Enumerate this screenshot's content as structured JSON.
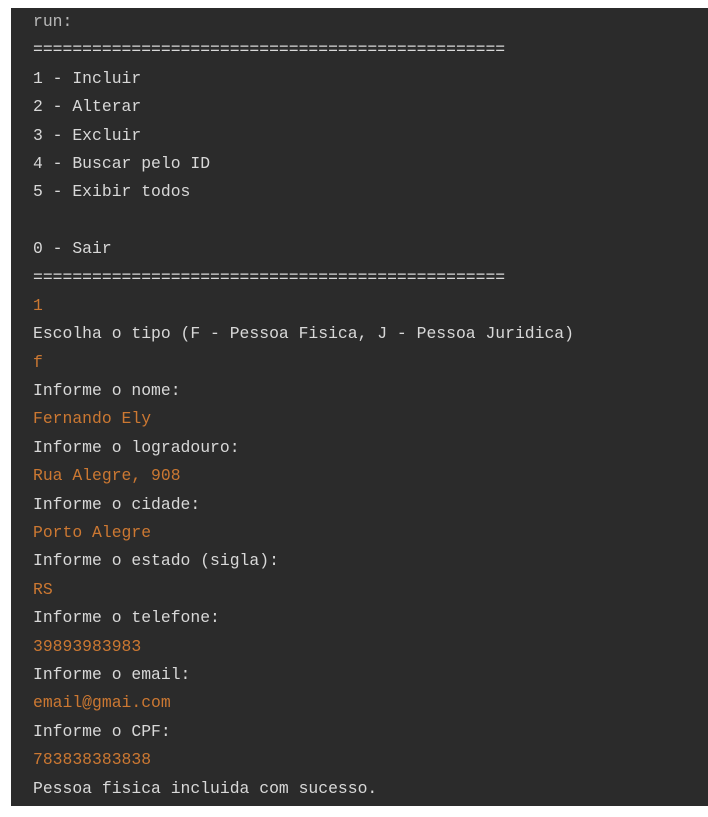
{
  "console": {
    "lines": [
      {
        "text": "run:",
        "kind": "header"
      },
      {
        "text": "================================================",
        "kind": "output"
      },
      {
        "text": "1 - Incluir",
        "kind": "output"
      },
      {
        "text": "2 - Alterar",
        "kind": "output"
      },
      {
        "text": "3 - Excluir",
        "kind": "output"
      },
      {
        "text": "4 - Buscar pelo ID",
        "kind": "output"
      },
      {
        "text": "5 - Exibir todos",
        "kind": "output"
      },
      {
        "text": "",
        "kind": "output"
      },
      {
        "text": "0 - Sair",
        "kind": "output"
      },
      {
        "text": "================================================",
        "kind": "output"
      },
      {
        "text": "1",
        "kind": "input"
      },
      {
        "text": "Escolha o tipo (F - Pessoa Fisica, J - Pessoa Juridica)",
        "kind": "output"
      },
      {
        "text": "f",
        "kind": "input"
      },
      {
        "text": "Informe o nome:",
        "kind": "output"
      },
      {
        "text": "Fernando Ely",
        "kind": "input"
      },
      {
        "text": "Informe o logradouro:",
        "kind": "output"
      },
      {
        "text": "Rua Alegre, 908",
        "kind": "input"
      },
      {
        "text": "Informe o cidade:",
        "kind": "output"
      },
      {
        "text": "Porto Alegre",
        "kind": "input"
      },
      {
        "text": "Informe o estado (sigla):",
        "kind": "output"
      },
      {
        "text": "RS",
        "kind": "input"
      },
      {
        "text": "Informe o telefone:",
        "kind": "output"
      },
      {
        "text": "39893983983",
        "kind": "input"
      },
      {
        "text": "Informe o email:",
        "kind": "output"
      },
      {
        "text": "email@gmai.com",
        "kind": "input"
      },
      {
        "text": "Informe o CPF:",
        "kind": "output"
      },
      {
        "text": "783838383838",
        "kind": "input"
      },
      {
        "text": "Pessoa fisica incluida com sucesso.",
        "kind": "output"
      }
    ]
  },
  "colors": {
    "background": "#2b2b2b",
    "output_text": "#d8d8d8",
    "input_text": "#cc7832"
  }
}
